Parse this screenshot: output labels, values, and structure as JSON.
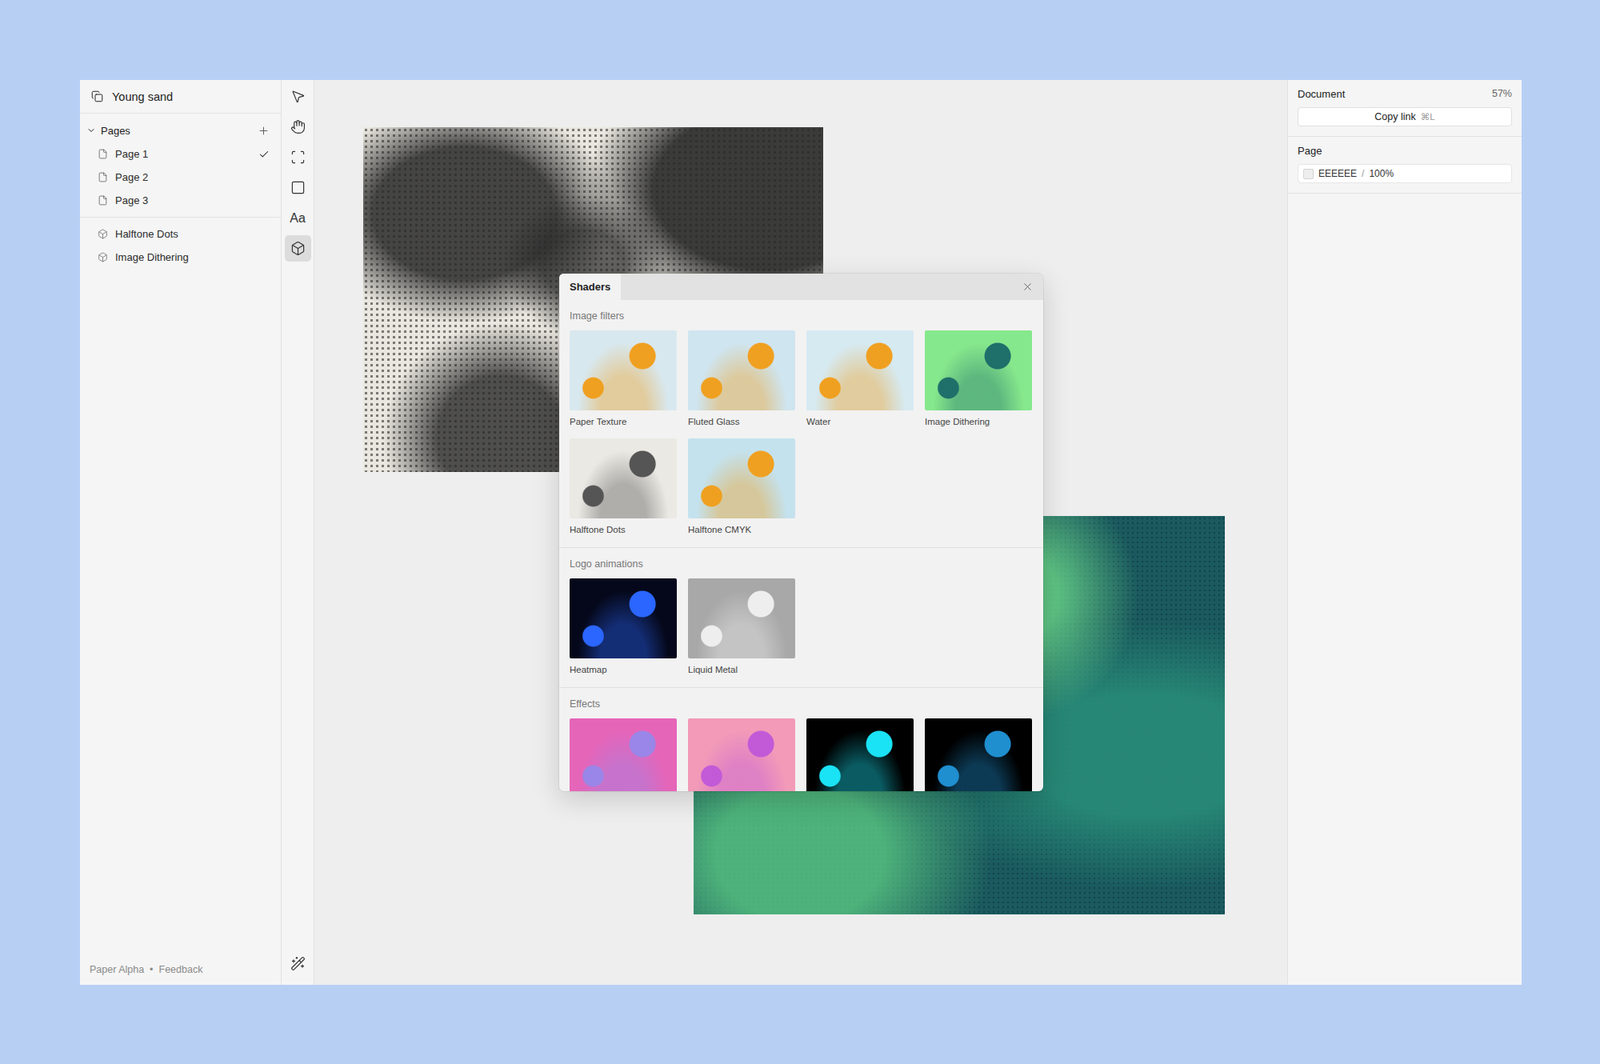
{
  "project": {
    "title": "Young sand"
  },
  "pages": {
    "label": "Pages",
    "expanded": true,
    "items": [
      {
        "label": "Page 1",
        "selected": true
      },
      {
        "label": "Page 2",
        "selected": false
      },
      {
        "label": "Page 3",
        "selected": false
      }
    ]
  },
  "layers": [
    {
      "label": "Halftone Dots"
    },
    {
      "label": "Image Dithering"
    }
  ],
  "footer": {
    "app": "Paper Alpha",
    "separator": "•",
    "link": "Feedback"
  },
  "tools": [
    {
      "kind": "pointer",
      "selected": false
    },
    {
      "kind": "hand",
      "selected": false
    },
    {
      "kind": "frame",
      "selected": false
    },
    {
      "kind": "rectangle",
      "selected": false
    },
    {
      "kind": "text",
      "label": "Aa",
      "selected": false
    },
    {
      "kind": "shader",
      "selected": true
    }
  ],
  "bottom_tool": {
    "kind": "wand",
    "selected": false
  },
  "document": {
    "label": "Document",
    "zoom": "57%",
    "copy_link": "Copy link",
    "shortcut": "⌘L"
  },
  "page": {
    "label": "Page",
    "fill": "EEEEEE",
    "separator": "/",
    "opacity": "100%"
  },
  "shaders": {
    "title": "Shaders",
    "sections": [
      {
        "title": "Image filters",
        "items": [
          {
            "label": "Paper Texture",
            "color": "#d8e8ef",
            "accent": "#f0a020"
          },
          {
            "label": "Fluted Glass",
            "color": "#cfe5f0",
            "accent": "#f0a020"
          },
          {
            "label": "Water",
            "color": "#d6eaf2",
            "accent": "#f0a020"
          },
          {
            "label": "Image Dithering",
            "color": "#86e88c",
            "accent": "#1f6f6a"
          },
          {
            "label": "Halftone Dots",
            "color": "#ebe9e3",
            "accent": "#555555"
          },
          {
            "label": "Halftone CMYK",
            "color": "#c4e2ee",
            "accent": "#f0a020"
          }
        ]
      },
      {
        "title": "Logo animations",
        "items": [
          {
            "label": "Heatmap",
            "color": "#05081a",
            "accent": "#2a66ff"
          },
          {
            "label": "Liquid Metal",
            "color": "#a8a8a8",
            "accent": "#eeeeee"
          }
        ]
      },
      {
        "title": "Effects",
        "items": [
          {
            "color": "#e565b9",
            "accent": "#9a86e8"
          },
          {
            "color": "#f29ab8",
            "accent": "#c25ad8"
          },
          {
            "color": "#000000",
            "accent": "#19e3f5"
          },
          {
            "color": "#000000",
            "accent": "#1f8fd0"
          }
        ]
      }
    ]
  }
}
